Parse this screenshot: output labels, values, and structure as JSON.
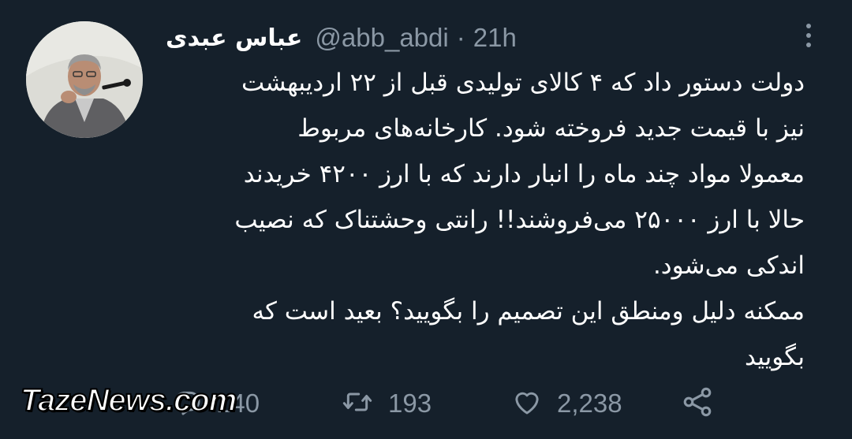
{
  "tweet": {
    "display_name": "عباس عبدی",
    "handle": "@abb_abdi",
    "separator": "·",
    "time": "21h",
    "lines": [
      "دولت دستور داد که ۴ کالای تولیدی قبل از ۲۲ اردیبهشت",
      "نیز با قیمت جدید فروخته شود. کارخانه‌های مربوط",
      "معمولا مواد چند ماه را انبار دارند که با ارز ۴۲۰۰ خریدند",
      "حالا با ارز ۲۵۰۰۰ می‌فروشند!! رانتی وحشتناک که نصیب",
      "اندکی می‌شود.",
      "ممکنه دلیل ومنطق این تصمیم را بگویید؟ بعید است که",
      "بگویید"
    ]
  },
  "actions": {
    "replies": "140",
    "retweets": "193",
    "likes": "2,238"
  },
  "watermark": "TazeNews.com",
  "icons": [
    "more-icon",
    "reply-icon",
    "retweet-icon",
    "like-icon",
    "share-icon"
  ],
  "colors": {
    "background": "#15202b",
    "text": "#ffffff",
    "secondary": "#8b98a5"
  }
}
